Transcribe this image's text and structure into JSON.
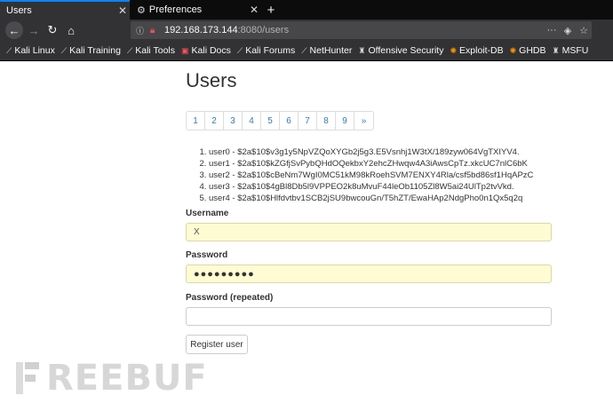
{
  "browser": {
    "tabs": [
      {
        "label": "Users",
        "active": true
      },
      {
        "label": "Preferences",
        "active": false
      }
    ],
    "url_host": "192.168.173.144",
    "url_path": ":8080/users",
    "bookmarks": [
      {
        "label": "Kali Linux",
        "icon": "kali-dragon-icon"
      },
      {
        "label": "Kali Training",
        "icon": "kali-dragon-icon"
      },
      {
        "label": "Kali Tools",
        "icon": "kali-dragon-icon"
      },
      {
        "label": "Kali Docs",
        "icon": "kali-docs-icon"
      },
      {
        "label": "Kali Forums",
        "icon": "kali-dragon-icon"
      },
      {
        "label": "NetHunter",
        "icon": "kali-dragon-icon"
      },
      {
        "label": "Offensive Security",
        "icon": "offsec-icon"
      },
      {
        "label": "Exploit-DB",
        "icon": "exploit-db-icon"
      },
      {
        "label": "GHDB",
        "icon": "ghdb-icon"
      },
      {
        "label": "MSFU",
        "icon": "msfu-icon"
      }
    ]
  },
  "page": {
    "title": "Users",
    "pagination": [
      "1",
      "2",
      "3",
      "4",
      "5",
      "6",
      "7",
      "8",
      "9",
      "»"
    ],
    "users": [
      "user0 - $2a$10$v3g1y5NpVZQoXYGb2j5g3.E5Vsnhj1W3tX/189zyw064VgTXIYV4.",
      "user1 - $2a$10$kZGfjSvPybQHdOQekbxY2ehcZHwqw4A3iAwsCpTz.xkcUC7nlC6bK",
      "user2 - $2a$10$cBeNm7WgI0MC51kM98kRoehSVM7ENXY4Rla/csf5bd86sf1HqAPzC",
      "user3 - $2a$10$4gBl8Db5l9VPPEO2k8uMvuF44leOb1105Zl8W5ai24UlTp2tvVkd.",
      "user4 - $2a$10$Hlfdvtbv1SCB2jSU9bwcouGn/T5hZT/EwaHAp2NdgPho0n1Qx5q2q"
    ],
    "form": {
      "username_label": "Username",
      "username_value": "X",
      "password_label": "Password",
      "password_value": "●●●●●●●●●",
      "password_repeat_label": "Password (repeated)",
      "password_repeat_value": "",
      "submit_label": "Register user"
    }
  },
  "watermark": {
    "text": "REEBUF"
  },
  "colors": {
    "link": "#337ab7",
    "autofill_bg": "#fffbd2",
    "chrome_dark": "#0c0c0d",
    "toolbar": "#323234",
    "tab_accent": "#0a84ff"
  }
}
